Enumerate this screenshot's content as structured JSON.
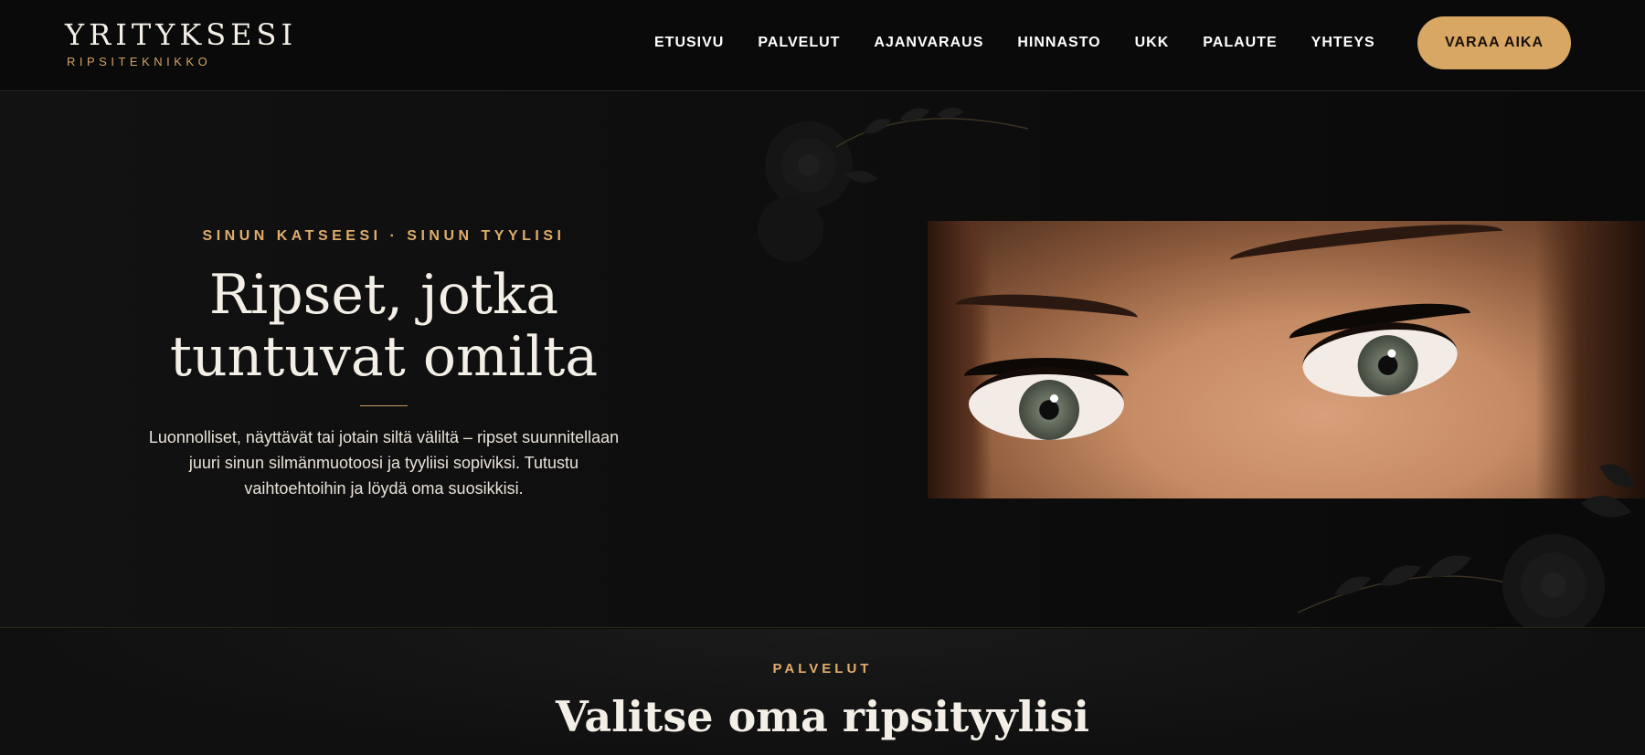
{
  "logo": {
    "name": "YRITYKSESI",
    "subtitle": "RIPSITEKNIKKO"
  },
  "nav": {
    "items": [
      {
        "label": "ETUSIVU"
      },
      {
        "label": "PALVELUT"
      },
      {
        "label": "AJANVARAUS"
      },
      {
        "label": "HINNASTO"
      },
      {
        "label": "UKK"
      },
      {
        "label": "PALAUTE"
      },
      {
        "label": "YHTEYS"
      }
    ],
    "cta_label": "VARAA AIKA"
  },
  "hero": {
    "eyebrow": "SINUN KATSEESI · SINUN TYYLISI",
    "title_line1": "Ripset, jotka",
    "title_line2": "tuntuvat omilta",
    "description": "Luonnolliset, näyttävät tai jotain siltä väliltä – ripset suunnitellaan juuri sinun silmänmuotoosi ja tyyliisi sopiviksi. Tutustu vaihtoehtoihin ja löydä oma suosikkisi."
  },
  "services": {
    "eyebrow": "PALVELUT",
    "title": "Valitse oma ripsityylisi"
  },
  "colors": {
    "accent": "#d9a764",
    "background": "#0b0b0b",
    "text": "#f4efe6"
  }
}
